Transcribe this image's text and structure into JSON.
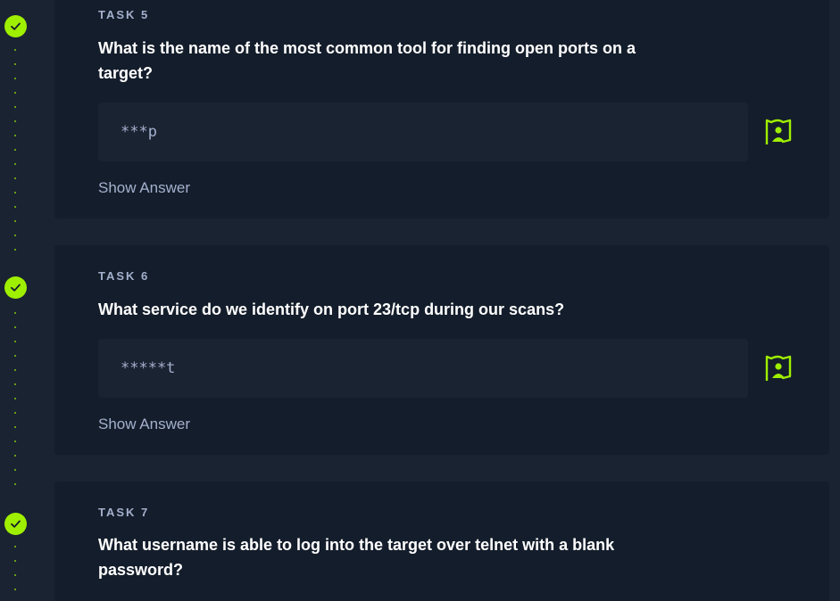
{
  "colors": {
    "background": "#1a2332",
    "card": "#141d2b",
    "accent": "#9fef00",
    "muted_text": "#a4b1cd",
    "text": "#ffffff"
  },
  "tasks": [
    {
      "label": "TASK 5",
      "question": "What is the name of the most common tool for finding open ports on a target?",
      "answer_placeholder": "***p",
      "show_answer": "Show Answer",
      "completed": true,
      "submit_icon": "flag-user-icon"
    },
    {
      "label": "TASK 6",
      "question": "What service do we identify on port 23/tcp during our scans?",
      "answer_placeholder": "*****t",
      "show_answer": "Show Answer",
      "completed": true,
      "submit_icon": "flag-user-icon"
    },
    {
      "label": "TASK 7",
      "question": "What username is able to log into the target over telnet with a blank password?",
      "completed": true
    }
  ]
}
